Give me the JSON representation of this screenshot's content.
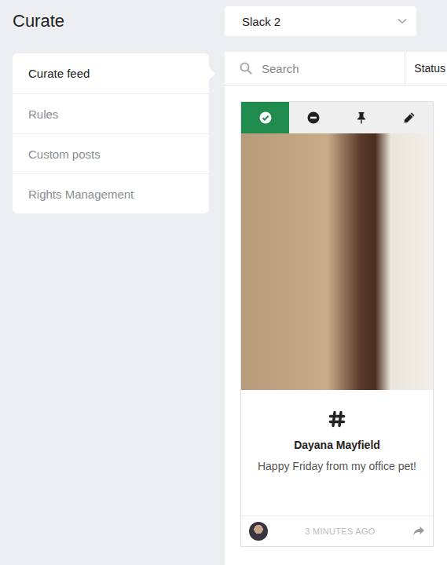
{
  "header": {
    "title": "Curate"
  },
  "source_dropdown": {
    "value": "Slack 2"
  },
  "sidebar": {
    "items": [
      {
        "label": "Curate feed",
        "selected": true
      },
      {
        "label": "Rules",
        "selected": false
      },
      {
        "label": "Custom posts",
        "selected": false
      },
      {
        "label": "Rights Management",
        "selected": false
      }
    ]
  },
  "search": {
    "placeholder": "Search"
  },
  "filter": {
    "label": "Status"
  },
  "post": {
    "toolbar": [
      {
        "kind": "approve",
        "selected": true
      },
      {
        "kind": "hide",
        "selected": false
      },
      {
        "kind": "pin",
        "selected": false
      },
      {
        "kind": "edit",
        "selected": false
      }
    ],
    "author": "Dayana Mayfield",
    "text": "Happy Friday from my office pet!",
    "time": "3 MINUTES AGO"
  }
}
